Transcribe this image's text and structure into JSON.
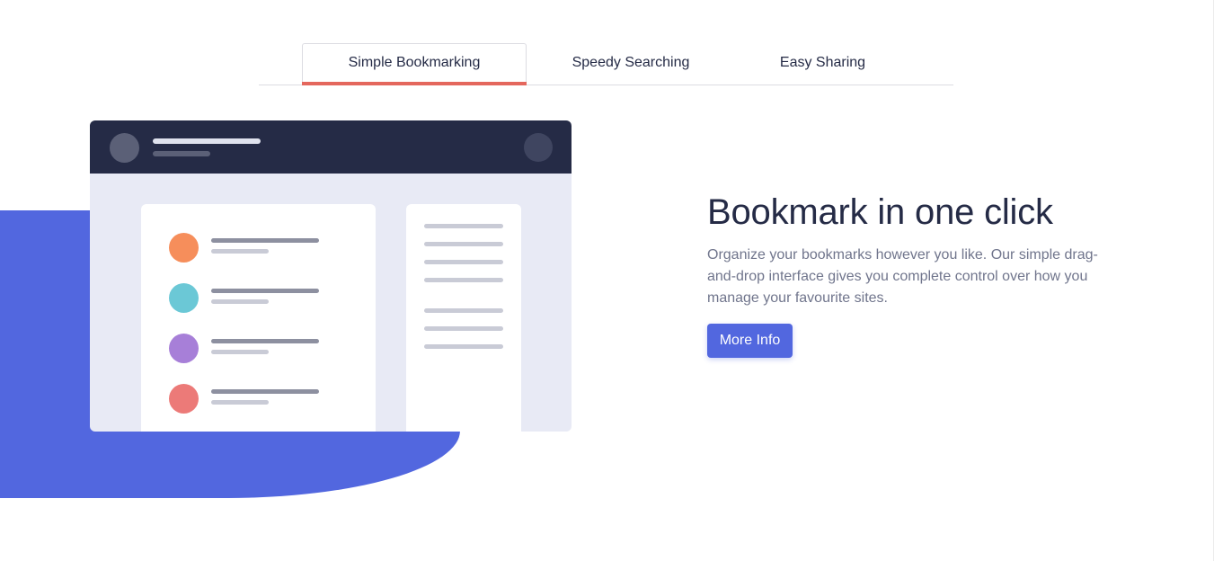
{
  "tabs": [
    {
      "label": "Simple Bookmarking",
      "active": true
    },
    {
      "label": "Speedy Searching",
      "active": false
    },
    {
      "label": "Easy Sharing",
      "active": false
    }
  ],
  "feature": {
    "title": "Bookmark in one click",
    "description": "Organize your bookmarks however you like. Our simple drag-and-drop interface gives you complete control over how you manage your favourite sites.",
    "button_label": "More Info"
  },
  "illustration": {
    "bookmark_icon_colors": [
      "#f68e5b",
      "#6bc8d6",
      "#a77fd8",
      "#ec7a78"
    ]
  },
  "colors": {
    "accent_blue": "#5267df",
    "accent_red": "#e4675d",
    "dark_navy": "#252b46",
    "text_gray": "#70758c"
  }
}
